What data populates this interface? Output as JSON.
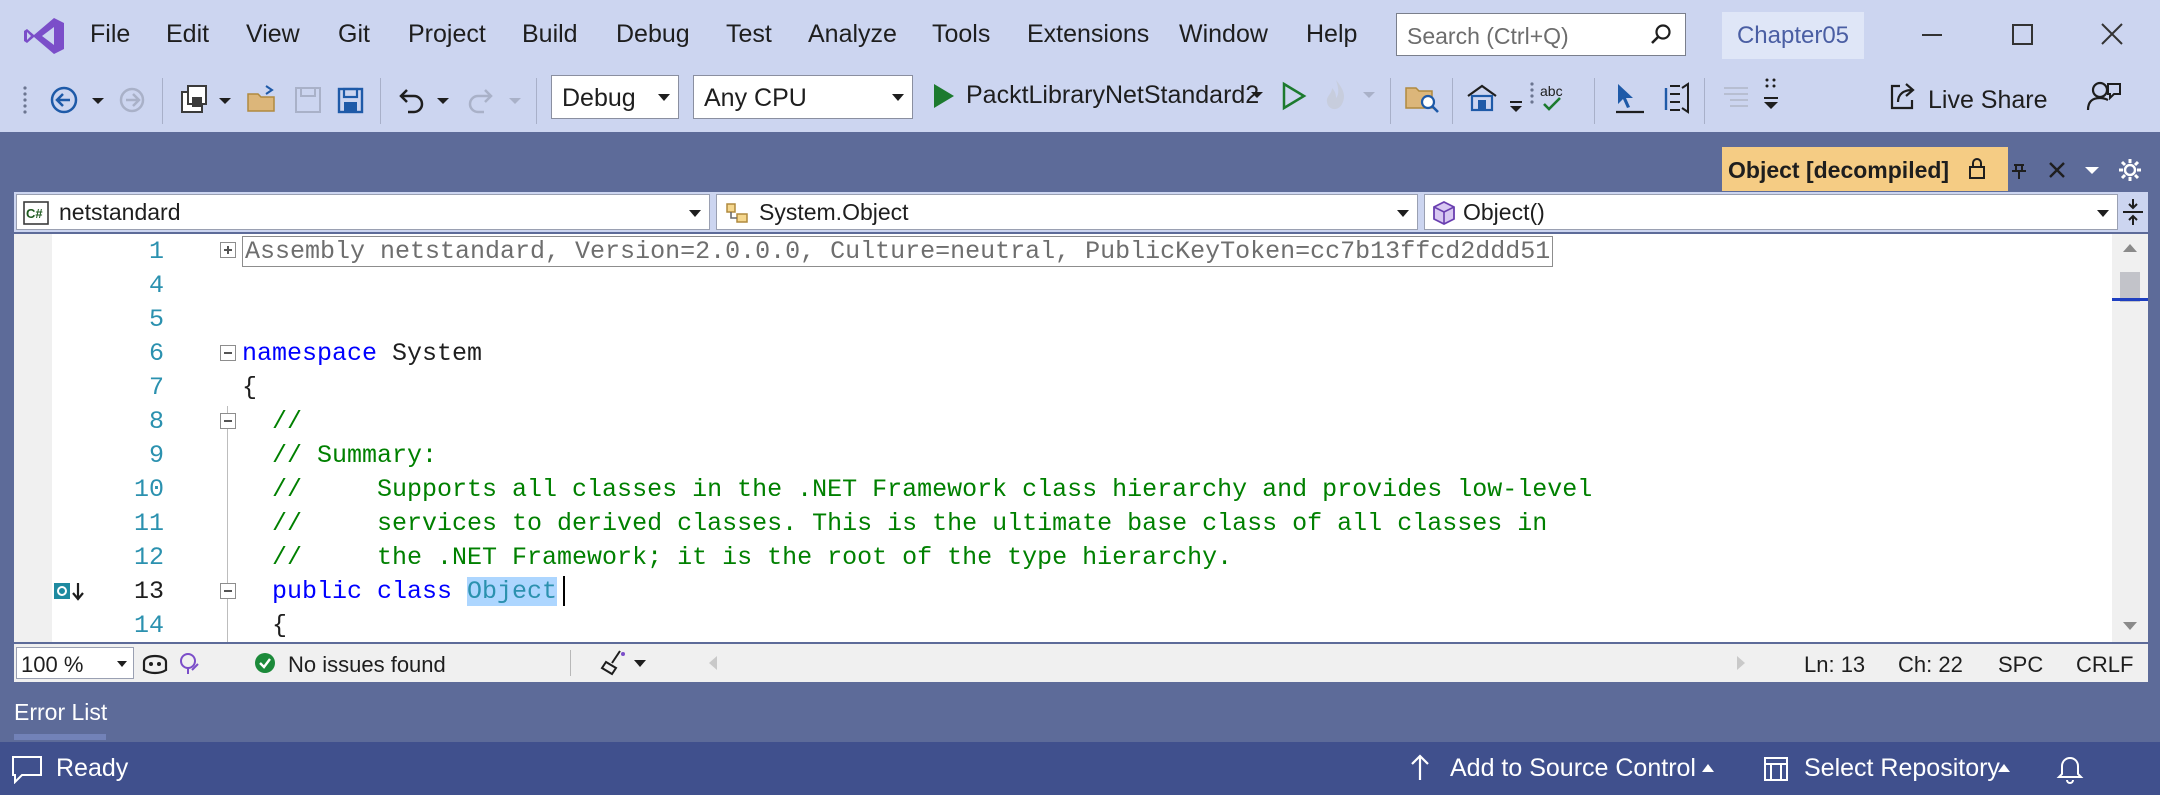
{
  "menu": {
    "items": [
      "File",
      "Edit",
      "View",
      "Git",
      "Project",
      "Build",
      "Debug",
      "Test",
      "Analyze",
      "Tools",
      "Extensions",
      "Window",
      "Help"
    ],
    "search_placeholder": "Search (Ctrl+Q)",
    "solution_name": "Chapter05"
  },
  "toolbar": {
    "configuration": "Debug",
    "platform": "Any CPU",
    "startup_project": "PacktLibraryNetStandard2",
    "live_share_label": "Live Share"
  },
  "document_tab": {
    "title": "Object [decompiled]"
  },
  "navbar": {
    "project": "netstandard",
    "type": "System.Object",
    "member": "Object()"
  },
  "editor": {
    "assembly_header": "Assembly netstandard, Version=2.0.0.0, Culture=neutral, PublicKeyToken=cc7b13ffcd2ddd51",
    "current_line": "13",
    "lines": [
      {
        "num": "1"
      },
      {
        "num": "4"
      },
      {
        "num": "5"
      },
      {
        "num": "6",
        "kw": "namespace",
        "rest": " System"
      },
      {
        "num": "7",
        "text": "{"
      },
      {
        "num": "8",
        "comment": "  //"
      },
      {
        "num": "9",
        "comment": "  // Summary:"
      },
      {
        "num": "10",
        "comment": "  //     Supports all classes in the .NET Framework class hierarchy and provides low-level"
      },
      {
        "num": "11",
        "comment": "  //     services to derived classes. This is the ultimate base class of all classes in"
      },
      {
        "num": "12",
        "comment": "  //     the .NET Framework; it is the root of the type hierarchy."
      },
      {
        "num": "13",
        "kw": "  public class ",
        "selected": "Object"
      },
      {
        "num": "14",
        "text": "  {"
      }
    ]
  },
  "editor_status": {
    "zoom": "100 %",
    "issues": "No issues found",
    "line": "Ln: 13",
    "char": "Ch: 22",
    "spacing": "SPC",
    "eol": "CRLF"
  },
  "error_list_label": "Error List",
  "statusbar": {
    "ready": "Ready",
    "source_control": "Add to Source Control",
    "repository": "Select Repository"
  },
  "colors": {
    "chrome": "#ccd5f0",
    "frame": "#5d6b99",
    "statusbar": "#40508d",
    "doc_tab": "#f5cc84",
    "keyword": "#0000ff",
    "comment": "#008000"
  }
}
